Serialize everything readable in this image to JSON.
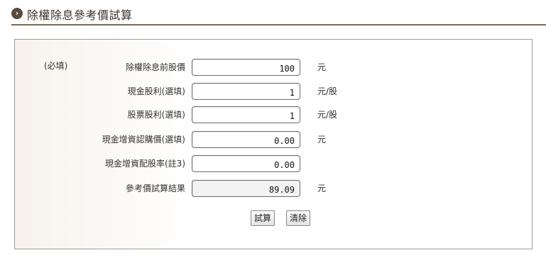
{
  "header": {
    "icon": "chevron-right-circle-icon",
    "title": "除權除息參考價試算"
  },
  "form": {
    "required_note": "(必填)",
    "rows": [
      {
        "label": "除權除息前股價",
        "value": "100",
        "unit": "元"
      },
      {
        "label": "現金股利(選填)",
        "value": "1",
        "unit": "元/股"
      },
      {
        "label": "股票股利(選填)",
        "value": "1",
        "unit": "元/股"
      },
      {
        "label": "現金增資認購價(選填)",
        "value": "0.00",
        "unit": "元"
      },
      {
        "label": "現金增資配股率(註3)",
        "value": "0.00",
        "unit": ""
      },
      {
        "label": "參考價試算結果",
        "value": "89.09",
        "unit": "元"
      }
    ],
    "buttons": {
      "calculate": "試算",
      "clear": "清除"
    }
  }
}
